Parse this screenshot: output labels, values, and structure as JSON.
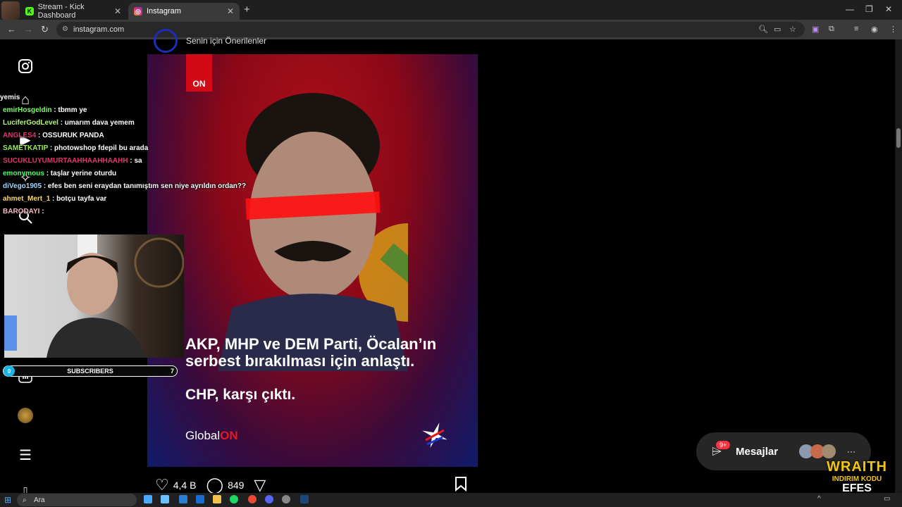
{
  "browser": {
    "tabs": [
      {
        "title": "Stream - Kick Dashboard",
        "icon": "kick-icon"
      },
      {
        "title": "Instagram",
        "icon": "instagram-icon"
      }
    ],
    "url": "instagram.com"
  },
  "feed": {
    "header": "Senin için Önerilenler",
    "post": {
      "logo": "ON",
      "headline": "AKP, MHP ve DEM Parti, Öcalan’ın serbest bırakılması için anlaştı.",
      "subline": "CHP, karşı çıktı.",
      "brand_prefix": "Global",
      "brand_suffix": "ON",
      "likes": "4,4 B",
      "comments": "849"
    }
  },
  "chat": {
    "messages": [
      {
        "user": "yemis",
        "text": "",
        "color": "#ffffff"
      },
      {
        "user": "emirHosgeldin",
        "text": ": tbmm ye",
        "color": "#7cfc6a"
      },
      {
        "user": "LuciferGodLevel",
        "text": ": umarım dava yemem",
        "color": "#b6f57a"
      },
      {
        "user": "ANGLES4",
        "text": ": OSSURUK PANDA",
        "color": "#e2356f"
      },
      {
        "user": "SAMETKATIP",
        "text": ": photowshop fdepil bu arada",
        "color": "#9bf04d"
      },
      {
        "user": "SUCUKLUYUMURTAAHHAAHHAAHH",
        "text": ": sa",
        "color": "#e2356f"
      },
      {
        "user": "emonymous",
        "text": ": taşlar yerine oturdu",
        "color": "#4cff6a"
      },
      {
        "user": "diVego1905",
        "text": ": efes ben seni eraydan tanımıştım sen niye ayrıldın ordan??",
        "color": "#9fd8ff"
      },
      {
        "user": "ahmet_Mert_1",
        "text": ": botçu tayfa var",
        "color": "#f5d76e"
      },
      {
        "user": "BARODAYI",
        "text": ":",
        "color": "#f5b7c0"
      }
    ]
  },
  "overlay": {
    "subs_label": "SUBSCRIBERS",
    "subs_left": "0",
    "subs_right": "7",
    "promo_title": "WRAITH",
    "promo_line": "INDIRIM KODU",
    "promo_code": "EFES"
  },
  "messages_widget": {
    "label": "Mesajlar",
    "badge": "9+"
  },
  "taskbar": {
    "search_placeholder": "Ara"
  },
  "colors": {
    "post_red": "#b0101a",
    "post_blue": "#101b6b",
    "brand_red": "#e01a22",
    "accent_yellow": "#f3c60b"
  }
}
